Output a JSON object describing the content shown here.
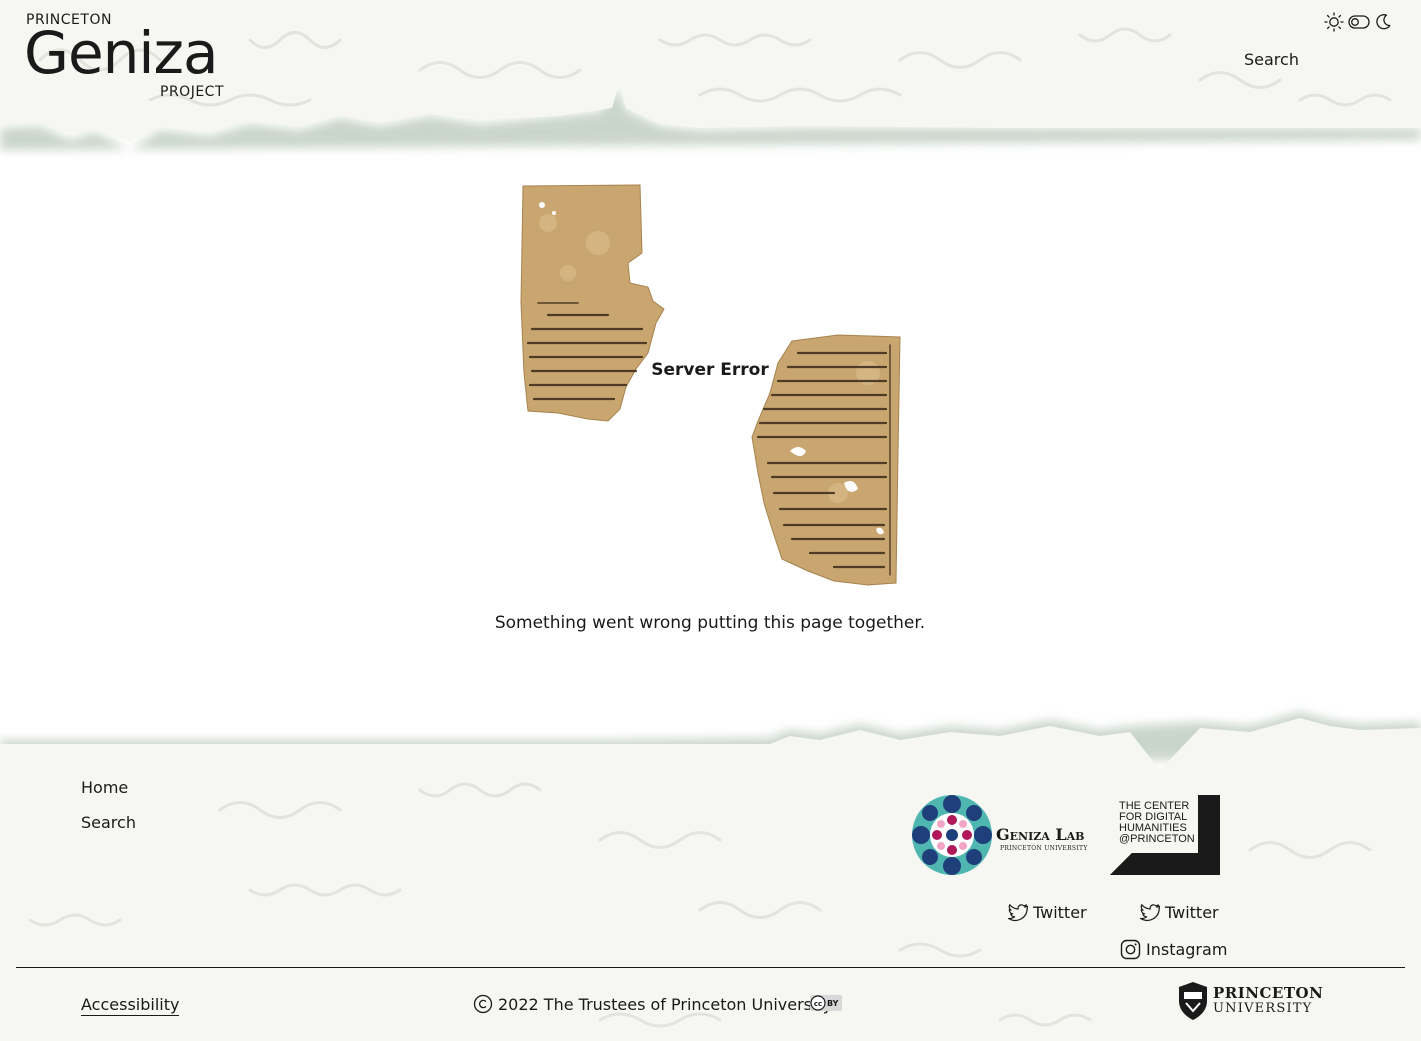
{
  "header": {
    "logo": {
      "top": "PRINCETON",
      "main": "Geniza",
      "bottom": "PROJECT"
    },
    "nav": {
      "search_label": "Search"
    },
    "theme_toggle": {
      "light_icon": "sun-icon",
      "toggle_icon": "toggle-icon",
      "dark_icon": "moon-icon"
    }
  },
  "main": {
    "error_title": "Server Error",
    "error_message": "Something went wrong putting this page together."
  },
  "footer": {
    "nav": {
      "home_label": "Home",
      "search_label": "Search"
    },
    "geniza_lab": {
      "name": "Geniza Lab",
      "subtitle": "PRINCETON UNIVERSITY"
    },
    "cdh": {
      "line1": "THE CENTER",
      "line2": "FOR DIGITAL",
      "line3": "HUMANITIES",
      "line4": "@PRINCETON"
    },
    "social": {
      "twitter_1": "Twitter",
      "twitter_2": "Twitter",
      "instagram": "Instagram"
    },
    "accessibility_label": "Accessibility",
    "copyright": "2022 The Trustees of Princeton University",
    "license_badge": "BY",
    "princeton": {
      "line1": "PRINCETON",
      "line2": "UNIVERSITY"
    }
  },
  "colors": {
    "text": "#1a1a1a",
    "parchment": "#c9a56f",
    "torn_edge_shadow": "#9fb3a0",
    "geniza_teal": "#4fb7b0",
    "geniza_navy": "#1f3f7a",
    "geniza_magenta": "#b0185a"
  }
}
